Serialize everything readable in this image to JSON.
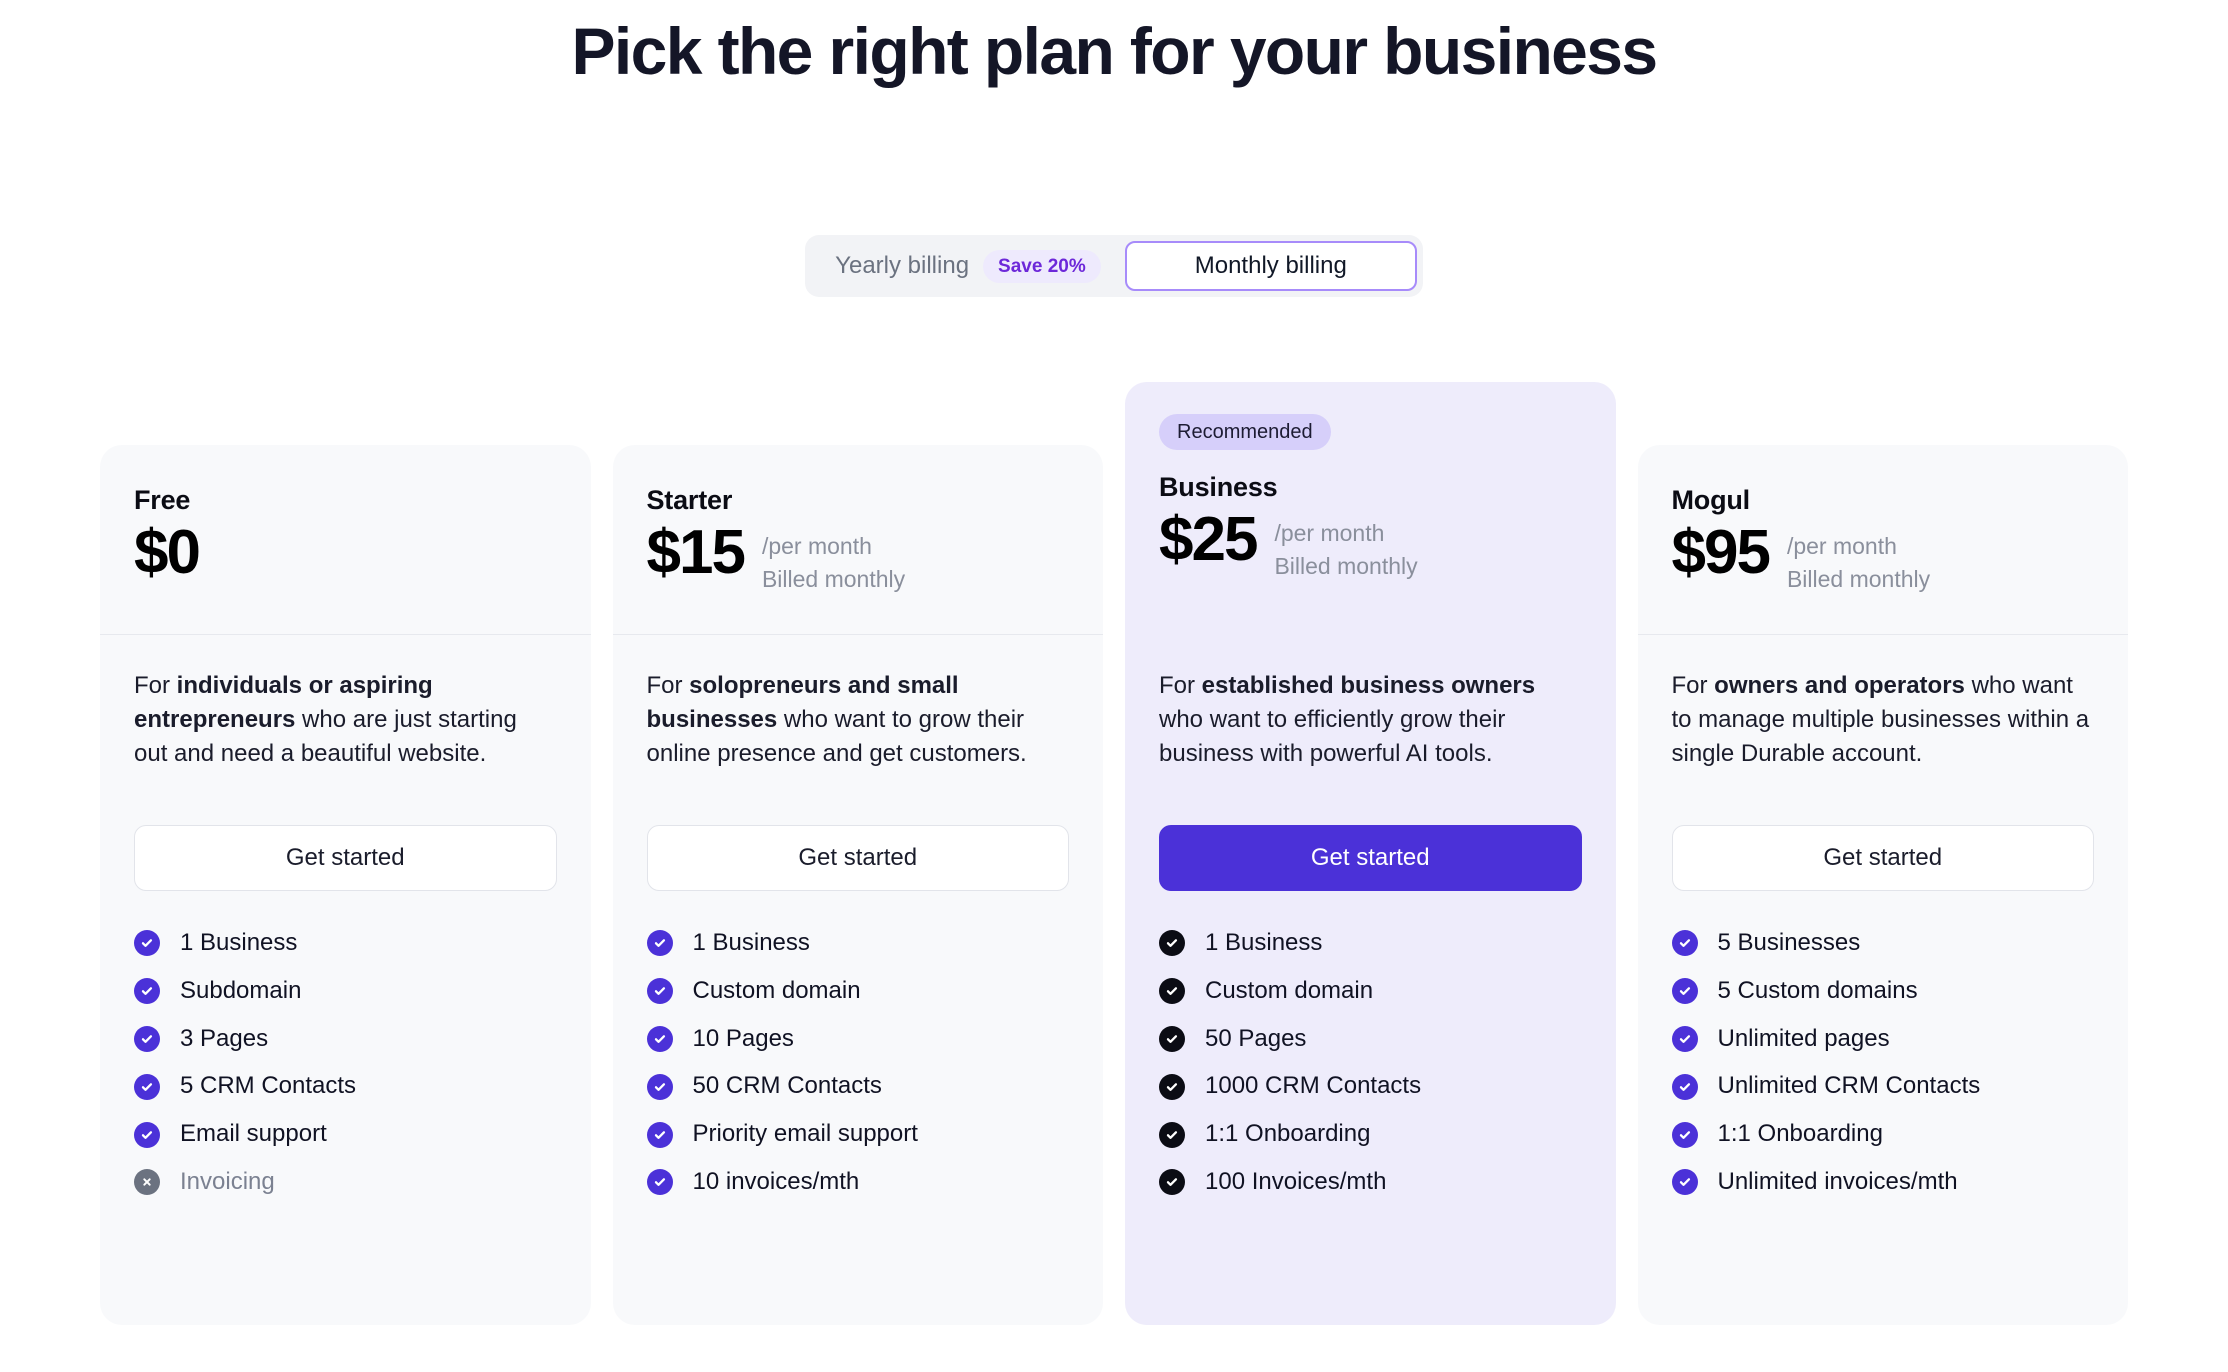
{
  "header": {
    "title": "Pick the right plan for your business"
  },
  "billing": {
    "yearly_label": "Yearly billing",
    "save_badge": "Save 20%",
    "monthly_label": "Monthly billing",
    "selected": "Monthly billing",
    "accent": "#6d28d9",
    "selected_border": "#a78bfa"
  },
  "plans": [
    {
      "name": "Free",
      "price": "$0",
      "per": "",
      "billed": "",
      "badge": "",
      "desc_pre": "For ",
      "desc_bold": "individuals or aspiring entrepreneurs",
      "desc_post": " who are just starting out and need a beautiful website.",
      "cta": "Get started",
      "features": [
        {
          "label": "1 Business",
          "state": "on"
        },
        {
          "label": "Subdomain",
          "state": "on"
        },
        {
          "label": "3 Pages",
          "state": "on"
        },
        {
          "label": "5 CRM Contacts",
          "state": "on"
        },
        {
          "label": "Email support",
          "state": "on"
        },
        {
          "label": "Invoicing",
          "state": "off"
        }
      ]
    },
    {
      "name": "Starter",
      "price": "$15",
      "per": "/per month",
      "billed": "Billed monthly",
      "badge": "",
      "desc_pre": "For ",
      "desc_bold": "solopreneurs and small businesses",
      "desc_post": " who want to grow their online presence and get customers.",
      "cta": "Get started",
      "features": [
        {
          "label": "1 Business",
          "state": "on"
        },
        {
          "label": "Custom domain",
          "state": "on"
        },
        {
          "label": "10 Pages",
          "state": "on"
        },
        {
          "label": "50 CRM Contacts",
          "state": "on"
        },
        {
          "label": "Priority email support",
          "state": "on"
        },
        {
          "label": "10 invoices/mth",
          "state": "on"
        }
      ]
    },
    {
      "name": "Business",
      "price": "$25",
      "per": "/per month",
      "billed": "Billed monthly",
      "badge": "Recommended",
      "desc_pre": "For ",
      "desc_bold": "established business owners",
      "desc_post": " who want to efficiently grow their business with powerful AI tools.",
      "cta": "Get started",
      "features": [
        {
          "label": "1 Business",
          "state": "dark"
        },
        {
          "label": "Custom domain",
          "state": "dark"
        },
        {
          "label": "50 Pages",
          "state": "dark"
        },
        {
          "label": "1000 CRM Contacts",
          "state": "dark"
        },
        {
          "label": "1:1 Onboarding",
          "state": "dark"
        },
        {
          "label": "100 Invoices/mth",
          "state": "dark"
        }
      ]
    },
    {
      "name": "Mogul",
      "price": "$95",
      "per": "/per month",
      "billed": "Billed monthly",
      "badge": "",
      "desc_pre": "For ",
      "desc_bold": "owners and operators",
      "desc_post": " who want to manage multiple businesses within a single Durable account.",
      "cta": "Get started",
      "features": [
        {
          "label": "5 Businesses",
          "state": "on"
        },
        {
          "label": "5 Custom domains",
          "state": "on"
        },
        {
          "label": "Unlimited pages",
          "state": "on"
        },
        {
          "label": "Unlimited CRM Contacts",
          "state": "on"
        },
        {
          "label": "1:1 Onboarding",
          "state": "on"
        },
        {
          "label": "Unlimited invoices/mth",
          "state": "on"
        }
      ]
    }
  ],
  "colors": {
    "accent_purple": "#4b31d8",
    "card_bg": "#f8f9fb",
    "featured_bg": "#eeecfb",
    "badge_bg": "#d6cffa",
    "text_dark": "#0b0c14",
    "text_muted": "#8a8f9c",
    "disabled_gray": "#6b7280"
  }
}
